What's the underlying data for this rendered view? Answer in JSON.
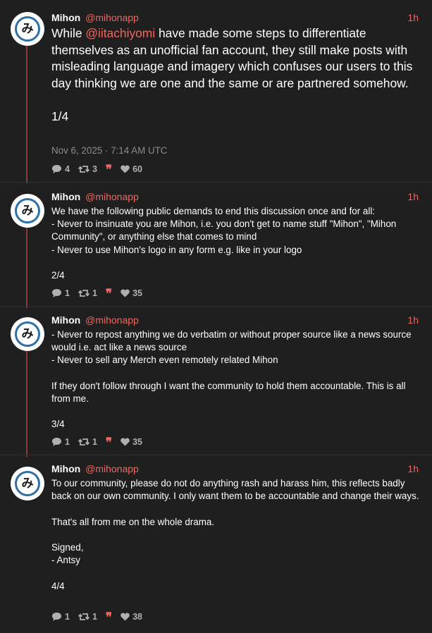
{
  "author": {
    "name": "Mihon",
    "handle": "@mihonapp",
    "avatar_glyph": "み"
  },
  "colors": {
    "accent": "#f2665c",
    "background": "#1f1f1f",
    "thread_line": "#8a3a3a",
    "avatar_ring": "#2f6fa8",
    "muted": "#8c8c8c"
  },
  "icons": {
    "reply": "comment-icon",
    "repost": "repost-icon",
    "quote": "quote-icon",
    "like": "heart-icon"
  },
  "posts": [
    {
      "time": "1h",
      "text_before_mention": "While ",
      "mention": "@iitachiyomi",
      "text_after_mention": " have made some steps to differentiate themselves as an unofficial fan account, they still make posts with misleading language and imagery which confuses our users to this day thinking we are one and the same or are partnered somehow.",
      "counter": "1/4",
      "timestamp": "Nov 6, 2025 · 7:14 AM UTC",
      "replies": "4",
      "reposts": "3",
      "likes": "60"
    },
    {
      "time": "1h",
      "paragraphs": [
        "We have the following public demands to end this discussion once and for all:\n- Never to insinuate you are Mihon, i.e. you don't get to name stuff \"Mihon\", \"Mihon Community\", or anything else that comes to mind\n- Never to use Mihon's logo in any form e.g. like in your logo",
        "2/4"
      ],
      "replies": "1",
      "reposts": "1",
      "likes": "35"
    },
    {
      "time": "1h",
      "paragraphs": [
        "- Never to repost anything we do verbatim or without proper source like a news source would i.e. act like a news source\n- Never to sell any Merch even remotely related Mihon",
        "If they don't follow through I want the community to hold them accountable. This is all from me.",
        "3/4"
      ],
      "replies": "1",
      "reposts": "1",
      "likes": "35"
    },
    {
      "time": "1h",
      "paragraphs": [
        "To our community, please do not do anything rash and harass him, this reflects badly back on our own community. I only want them to be accountable and change their ways.",
        "That's all from me on the whole drama.",
        "Signed,\n- Antsy",
        "4/4"
      ],
      "replies": "1",
      "reposts": "1",
      "likes": "38"
    }
  ]
}
